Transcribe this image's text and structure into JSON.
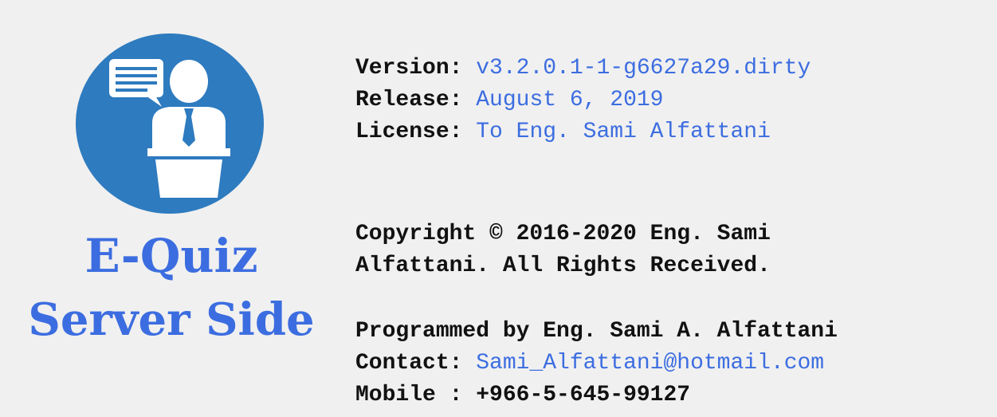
{
  "logo": {
    "icon": "presenter-at-podium-icon",
    "circle_color": "#2e7bbf",
    "figure_color": "#ffffff"
  },
  "app_title": {
    "line1": "E-Quiz",
    "line2": "Server Side",
    "color": "#3c6de0"
  },
  "version_block": {
    "version_label": "Version:",
    "version_value": "v3.2.0.1-1-g6627a29.dirty",
    "release_label": "Release:",
    "release_value": "August 6, 2019",
    "license_label": "License:",
    "license_value": "To Eng. Sami Alfattani"
  },
  "copyright": {
    "line1": "Copyright © 2016-2020 Eng. Sami",
    "line2": "Alfattani. All Rights Received."
  },
  "contact_block": {
    "programmed_by": "Programmed by Eng. Sami A. Alfattani",
    "contact_label": "Contact:",
    "contact_email": "Sami_Alfattani@hotmail.com",
    "mobile_label": "Mobile :",
    "mobile_value": "+966-5-645-99127"
  },
  "colors": {
    "background": "#f0f0f0",
    "accent": "#3c6de0",
    "text": "#111111"
  }
}
